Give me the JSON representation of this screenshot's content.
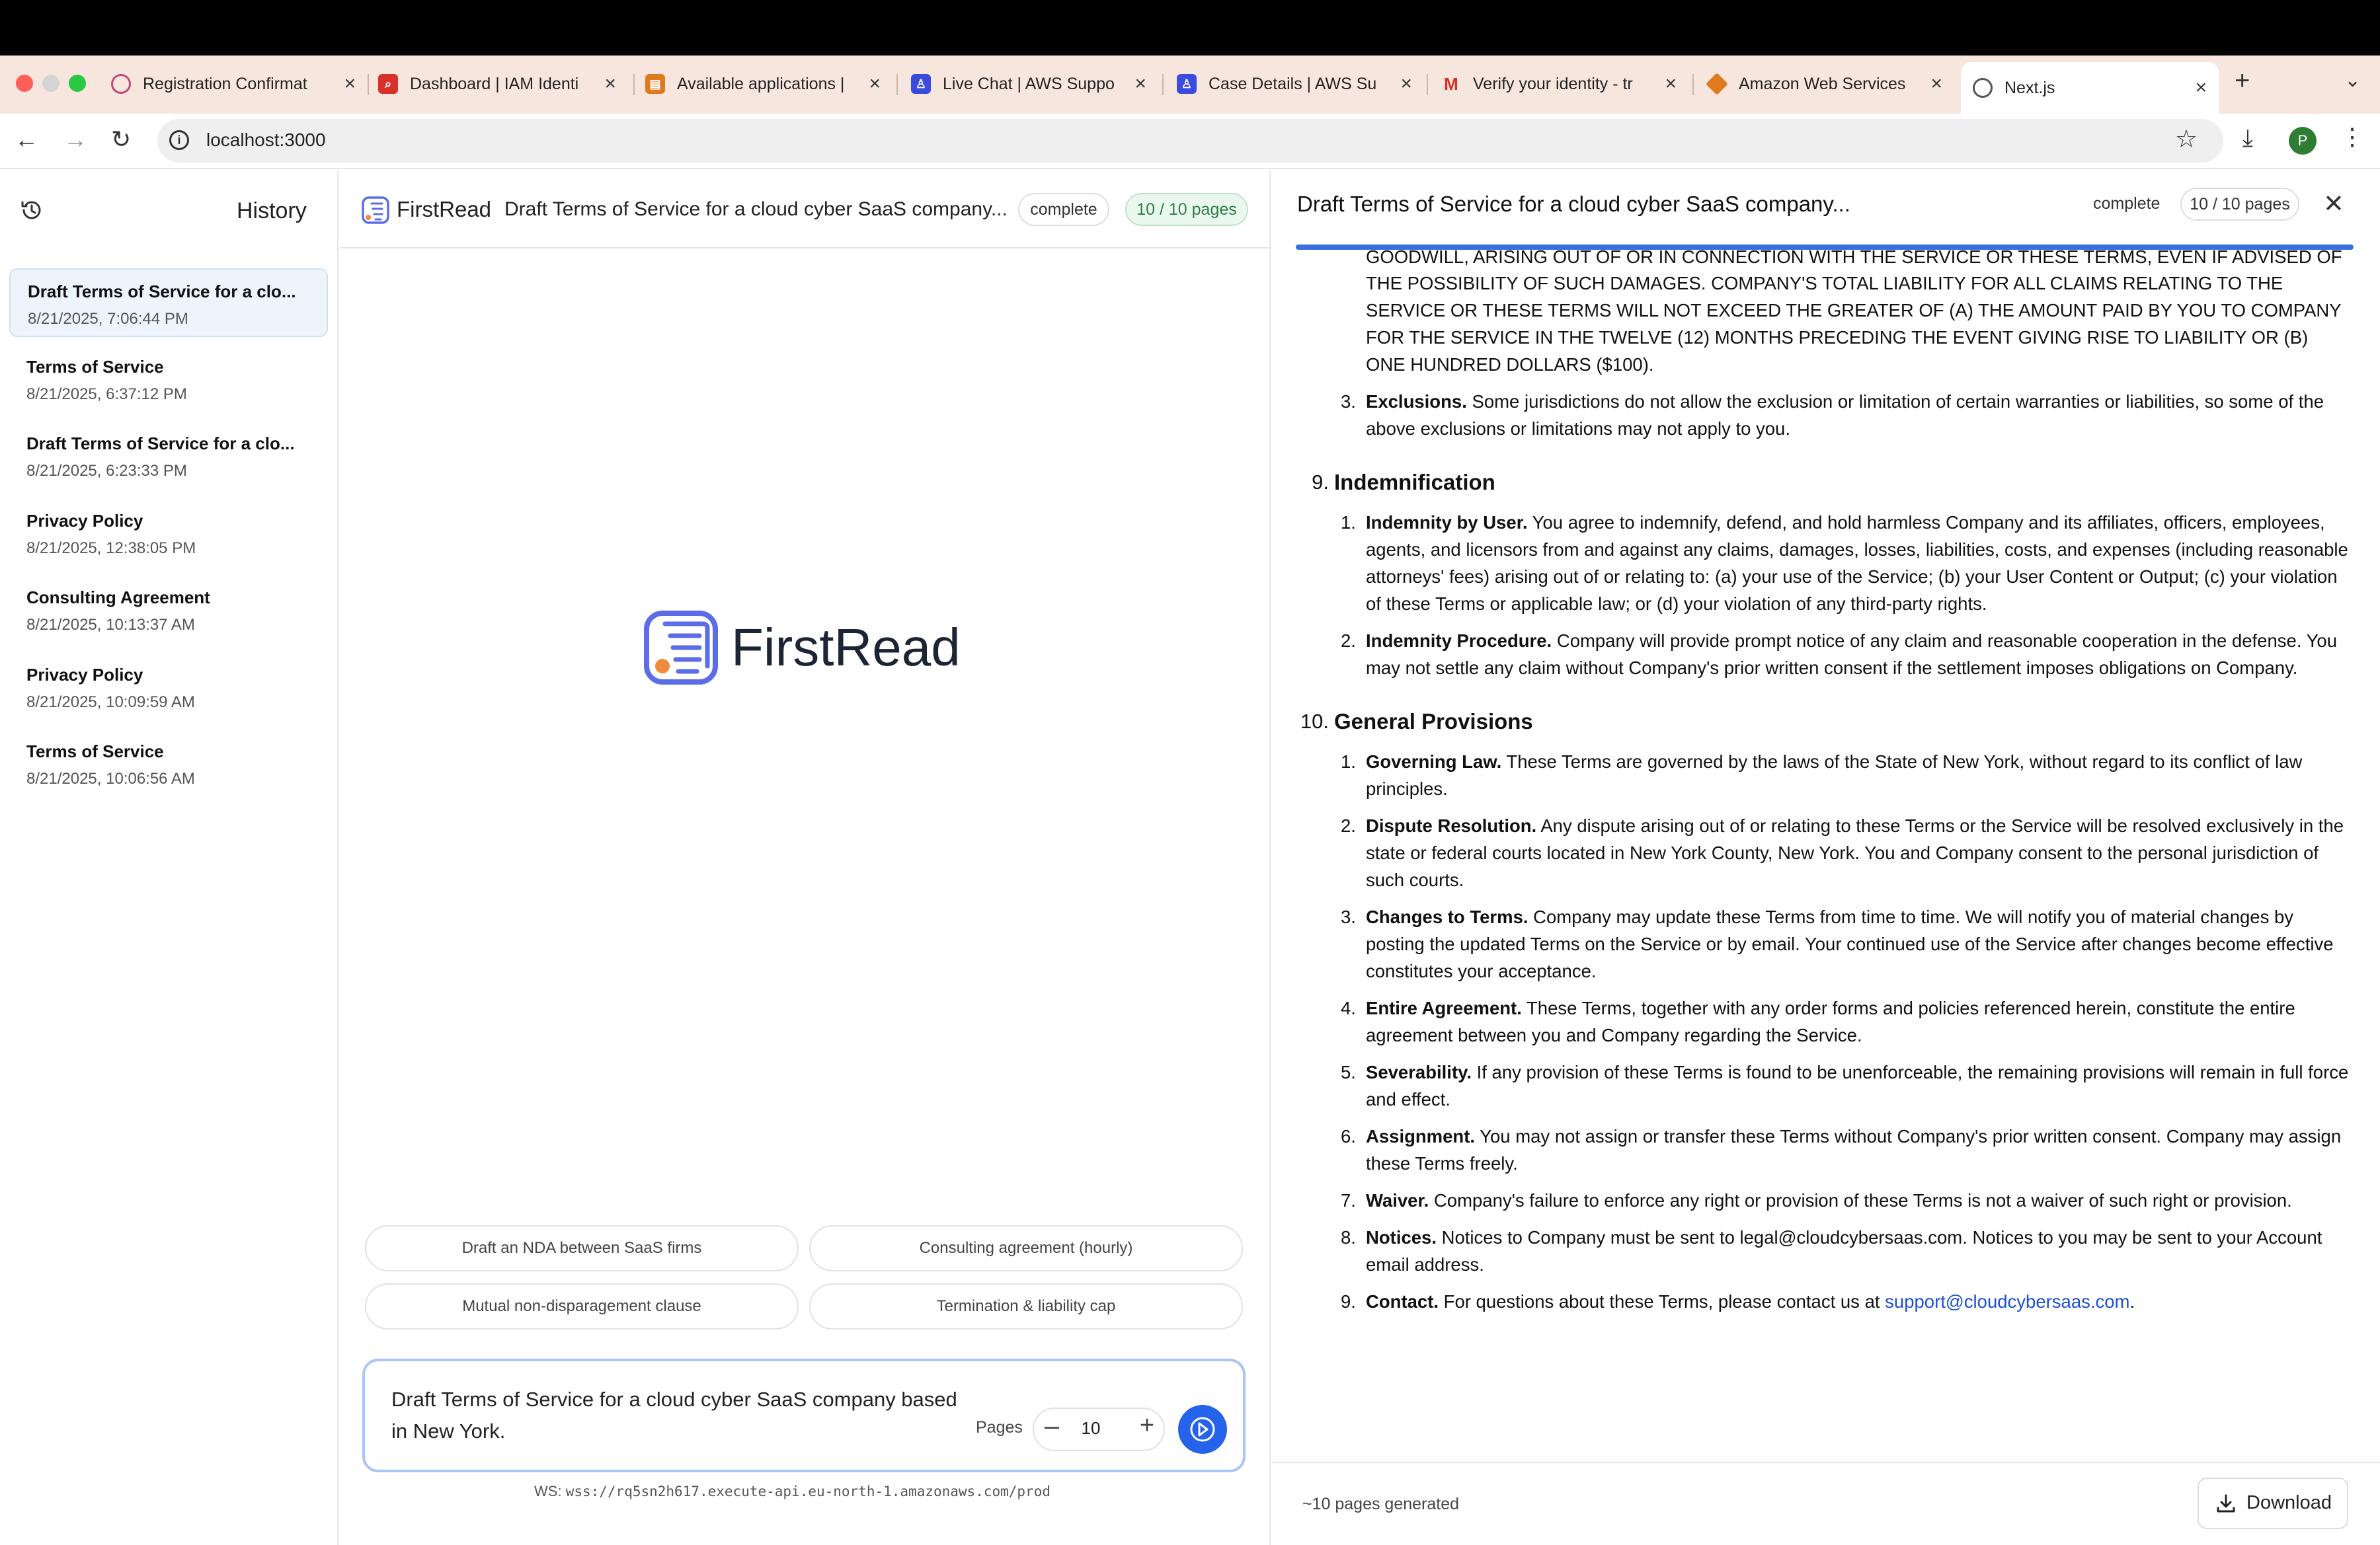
{
  "browser": {
    "tabs": [
      {
        "title": "Registration Confirmat",
        "favicon_color": "#ffffff",
        "favicon_icon": "registration-icon"
      },
      {
        "title": "Dashboard | IAM Identi",
        "favicon_color": "#d9302c",
        "favicon_icon": "iam-icon"
      },
      {
        "title": "Available applications |",
        "favicon_color": "#e07a1f",
        "favicon_icon": "aws-apps-icon"
      },
      {
        "title": "Live Chat | AWS Suppo",
        "favicon_color": "#3b4bdb",
        "favicon_icon": "aws-support-icon"
      },
      {
        "title": "Case Details | AWS Su",
        "favicon_color": "#3b4bdb",
        "favicon_icon": "aws-support-icon"
      },
      {
        "title": "Verify your identity - tr",
        "favicon_color": "#ffffff",
        "favicon_icon": "gmail-icon"
      },
      {
        "title": "Amazon Web Services",
        "favicon_color": "#e07a1f",
        "favicon_icon": "aws-cube-icon"
      },
      {
        "title": "Next.js",
        "favicon_color": "#ffffff",
        "favicon_icon": "globe-icon"
      }
    ],
    "url": "localhost:3000",
    "avatar_initial": "P"
  },
  "sidebar": {
    "title": "History",
    "items": [
      {
        "title": "Draft Terms of Service for a clo...",
        "date": "8/21/2025, 7:06:44 PM"
      },
      {
        "title": "Terms of Service",
        "date": "8/21/2025, 6:37:12 PM"
      },
      {
        "title": "Draft Terms of Service for a clo...",
        "date": "8/21/2025, 6:23:33 PM"
      },
      {
        "title": "Privacy Policy",
        "date": "8/21/2025, 12:38:05 PM"
      },
      {
        "title": "Consulting Agreement",
        "date": "8/21/2025, 10:13:37 AM"
      },
      {
        "title": "Privacy Policy",
        "date": "8/21/2025, 10:09:59 AM"
      },
      {
        "title": "Terms of Service",
        "date": "8/21/2025, 10:06:56 AM"
      }
    ]
  },
  "center": {
    "brand": "FirstRead",
    "title": "Draft Terms of Service for a cloud cyber SaaS company...",
    "status": "complete",
    "pages_badge": "10 / 10 pages",
    "suggestions": [
      "Draft an NDA between SaaS firms",
      "Consulting agreement (hourly)",
      "Mutual non-disparagement clause",
      "Termination & liability cap"
    ],
    "composer_text": "Draft Terms of Service for a cloud cyber SaaS company based in New York.",
    "pages_label": "Pages",
    "pages_value": "10",
    "ws_prefix": "WS:",
    "ws_url": "wss://rq5sn2h617.execute-api.eu-north-1.amazonaws.com/prod"
  },
  "doc": {
    "title": "Draft Terms of Service for a cloud cyber SaaS company...",
    "status": "complete",
    "pages_badge": "10 / 10 pages",
    "cut_line": "GOODWILL, ARISING OUT OF OR IN CONNECTION WITH THE SERVICE OR THESE TERMS, EVEN IF ADVISED OF",
    "cont_para": "THE POSSIBILITY OF SUCH DAMAGES. COMPANY'S TOTAL LIABILITY FOR ALL CLAIMS RELATING TO THE SERVICE OR THESE TERMS WILL NOT EXCEED THE GREATER OF (A) THE AMOUNT PAID BY YOU TO COMPANY FOR THE SERVICE IN THE TWELVE (12) MONTHS PRECEDING THE EVENT GIVING RISE TO LIABILITY OR (B) ONE HUNDRED DOLLARS ($100).",
    "s8_item3": {
      "num": "3.",
      "head": "Exclusions.",
      "text": " Some jurisdictions do not allow the exclusion or limitation of certain warranties or liabilities, so some of the above exclusions or limitations may not apply to you."
    },
    "s9": {
      "num": "9.",
      "title": "Indemnification"
    },
    "s9_items": [
      {
        "num": "1.",
        "head": "Indemnity by User.",
        "text": " You agree to indemnify, defend, and hold harmless Company and its affiliates, officers, employees, agents, and licensors from and against any claims, damages, losses, liabilities, costs, and expenses (including reasonable attorneys' fees) arising out of or relating to: (a) your use of the Service; (b) your User Content or Output; (c) your violation of these Terms or applicable law; or (d) your violation of any third-party rights."
      },
      {
        "num": "2.",
        "head": "Indemnity Procedure.",
        "text": " Company will provide prompt notice of any claim and reasonable cooperation in the defense. You may not settle any claim without Company's prior written consent if the settlement imposes obligations on Company."
      }
    ],
    "s10": {
      "num": "10.",
      "title": "General Provisions"
    },
    "s10_items": [
      {
        "num": "1.",
        "head": "Governing Law.",
        "text": " These Terms are governed by the laws of the State of New York, without regard to its conflict of law principles."
      },
      {
        "num": "2.",
        "head": "Dispute Resolution.",
        "text": " Any dispute arising out of or relating to these Terms or the Service will be resolved exclusively in the state or federal courts located in New York County, New York. You and Company consent to the personal jurisdiction of such courts."
      },
      {
        "num": "3.",
        "head": "Changes to Terms.",
        "text": " Company may update these Terms from time to time. We will notify you of material changes by posting the updated Terms on the Service or by email. Your continued use of the Service after changes become effective constitutes your acceptance."
      },
      {
        "num": "4.",
        "head": "Entire Agreement.",
        "text": " These Terms, together with any order forms and policies referenced herein, constitute the entire agreement between you and Company regarding the Service."
      },
      {
        "num": "5.",
        "head": "Severability.",
        "text": " If any provision of these Terms is found to be unenforceable, the remaining provisions will remain in full force and effect."
      },
      {
        "num": "6.",
        "head": "Assignment.",
        "text": " You may not assign or transfer these Terms without Company's prior written consent. Company may assign these Terms freely."
      },
      {
        "num": "7.",
        "head": "Waiver.",
        "text": " Company's failure to enforce any right or provision of these Terms is not a waiver of such right or provision."
      },
      {
        "num": "8.",
        "head": "Notices.",
        "text": " Notices to Company must be sent to legal@cloudcybersaas.com. Notices to you may be sent to your Account email address."
      }
    ],
    "s10_item9": {
      "num": "9.",
      "head": "Contact.",
      "text": " For questions about these Terms, please contact us at ",
      "link": "support@cloudcybersaas.com",
      "after": "."
    },
    "footer_note": "~10 pages generated",
    "download_label": "Download"
  },
  "colors": {
    "accent": "#2563eb",
    "tabstrip": "#f7e6dd",
    "pages_badge_bg": "#e9f7ee"
  }
}
